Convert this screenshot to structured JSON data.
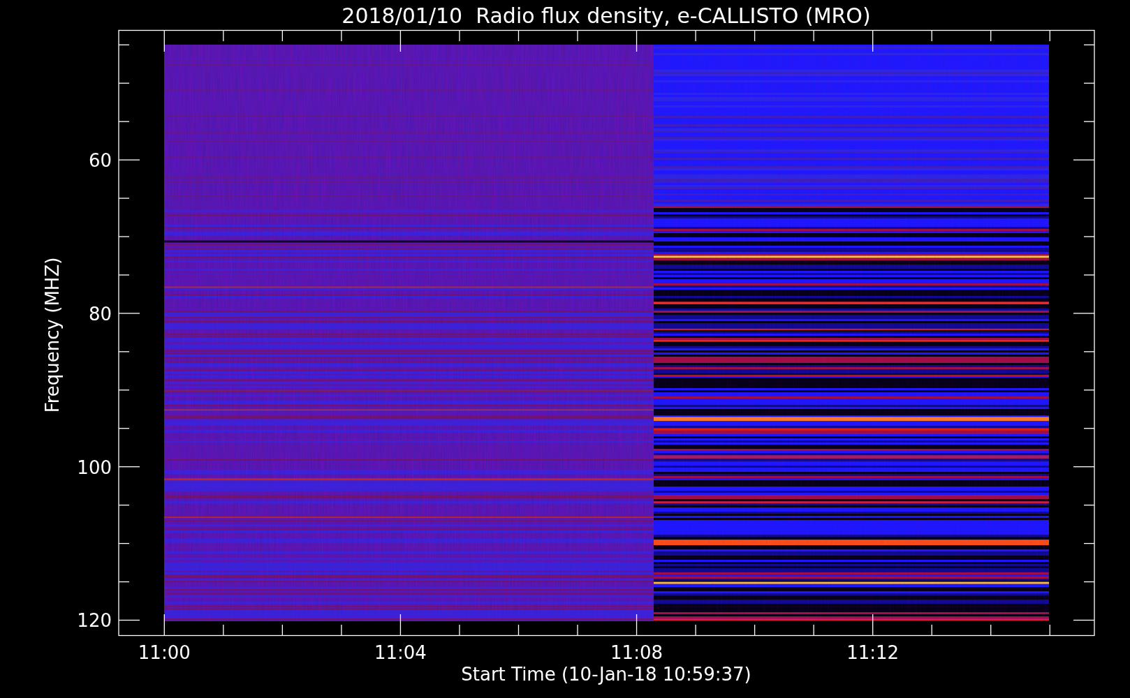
{
  "title": "2018/01/10  Radio flux density, e-CALLISTO (MRO)",
  "y_axis": {
    "label": "Frequency (MHZ)",
    "ticks": [
      "60",
      "80",
      "100",
      "120"
    ]
  },
  "x_axis": {
    "label": "Start Time (10-Jan-18 10:59:37)",
    "ticks": [
      "11:00",
      "11:04",
      "11:08",
      "11:12"
    ]
  }
}
